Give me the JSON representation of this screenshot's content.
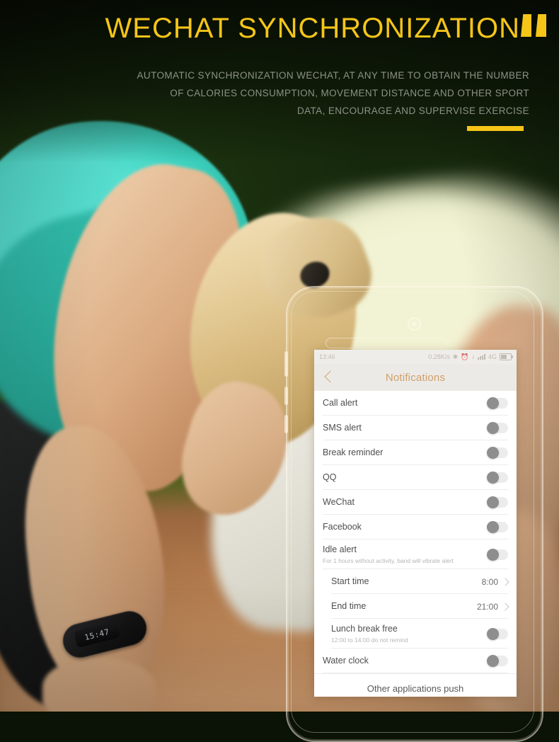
{
  "header": {
    "title": "WECHAT SYNCHRONIZATION",
    "subtitle_lines": [
      "AUTOMATIC SYNCHRONIZATION WECHAT, AT ANY TIME TO OBTAIN THE NUMBER",
      "OF CALORIES CONSUMPTION, MOVEMENT DISTANCE AND OTHER SPORT",
      "DATA, ENCOURAGE AND SUPERVISE  EXERCISE"
    ],
    "accent_color": "#F5C518",
    "subtitle_color": "#8d9287"
  },
  "phone": {
    "status_bar": {
      "time": "13:46",
      "network_speed": "0.28K/s",
      "bluetooth_icon": "bluetooth-icon",
      "alarm_icon": "alarm-clock-icon",
      "mute_icon": "mute-icon",
      "signal_icon": "signal-bars-icon",
      "network_type": "4G",
      "battery_icon": "battery-icon"
    },
    "nav": {
      "back_icon": "back-chevron-icon",
      "title": "Notifications",
      "title_color": "#cf9f6b"
    },
    "rows": [
      {
        "label": "Call alert",
        "type": "toggle",
        "state": "off",
        "indent": false
      },
      {
        "label": "SMS alert",
        "type": "toggle",
        "state": "off",
        "indent": false
      },
      {
        "label": "Break reminder",
        "type": "toggle",
        "state": "off",
        "indent": false
      },
      {
        "label": "QQ",
        "type": "toggle",
        "state": "off",
        "indent": false
      },
      {
        "label": "WeChat",
        "type": "toggle",
        "state": "off",
        "indent": false
      },
      {
        "label": "Facebook",
        "type": "toggle",
        "state": "off",
        "indent": false
      },
      {
        "label": "Idle alert",
        "sub": "For 1 hours without activity, band will vibrate alert",
        "type": "toggle",
        "state": "off",
        "indent": false
      },
      {
        "label": "Start time",
        "type": "value",
        "value": "8:00",
        "indent": true
      },
      {
        "label": "End time",
        "type": "value",
        "value": "21:00",
        "indent": true
      },
      {
        "label": "Lunch break free",
        "sub": "12:00 to 14:00 do not remind",
        "type": "toggle",
        "state": "off",
        "indent": true
      },
      {
        "label": "Water clock",
        "type": "toggle",
        "state": "off",
        "indent": false
      }
    ],
    "footer_button": "Other applications push"
  },
  "wristband": {
    "display_text": "15:47"
  }
}
